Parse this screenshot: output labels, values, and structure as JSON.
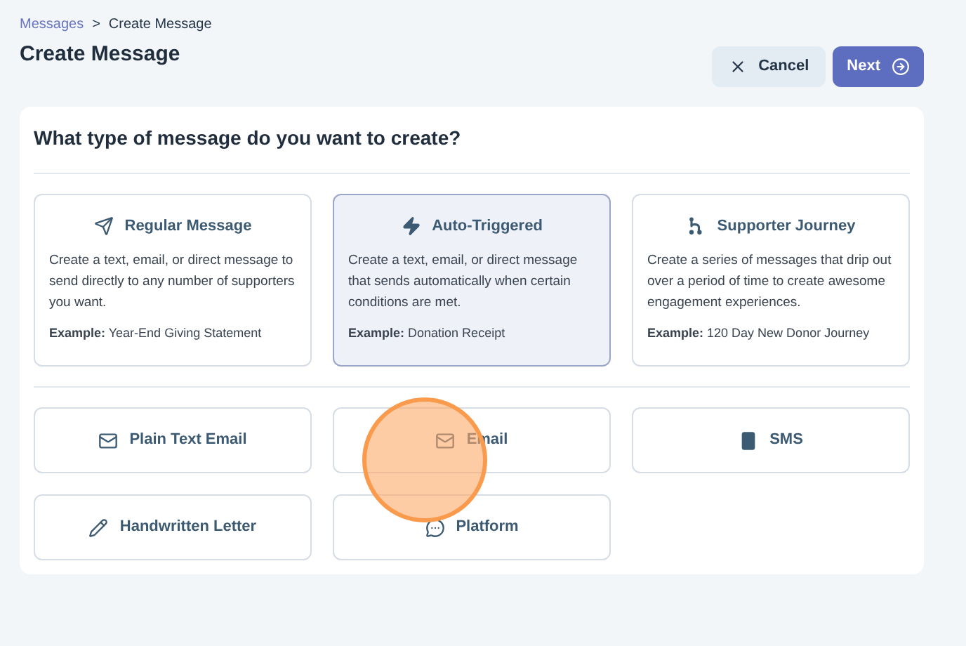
{
  "breadcrumb": {
    "link": "Messages",
    "separator": ">",
    "current": "Create Message"
  },
  "title": "Create Message",
  "buttons": {
    "cancel": "Cancel",
    "next": "Next"
  },
  "question": "What type of message do you want to create?",
  "message_types": [
    {
      "kind": "regular",
      "title": "Regular Message",
      "description": "Create a text, email, or direct message to send directly to any number of supporters you want.",
      "example": "**Example:** Year-End Giving Statement",
      "selected": false
    },
    {
      "kind": "auto",
      "title": "Auto-Triggered",
      "description": "Create a text, email, or direct message that sends automatically when certain conditions are met.",
      "example": "**Example:** Donation Receipt",
      "selected": true
    },
    {
      "kind": "journey",
      "title": "Supporter Journey",
      "description": "Create a series of messages that drip out over a period of time to create awesome engagement experiences.",
      "example": "**Example:** 120 Day New Donor Journey",
      "selected": false
    }
  ],
  "channels": [
    {
      "kind": "mail",
      "label": "Plain Text Email"
    },
    {
      "kind": "mail",
      "label": "Email"
    },
    {
      "kind": "phone",
      "label": "SMS"
    },
    {
      "kind": "pencil",
      "label": "Handwritten Letter"
    },
    {
      "kind": "chat",
      "label": "Platform"
    }
  ]
}
